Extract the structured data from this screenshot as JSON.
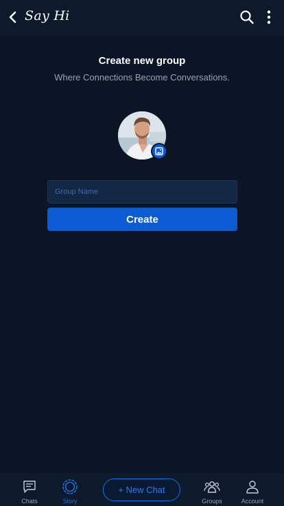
{
  "header": {
    "app_title": "Say Hi",
    "back_icon": "chevron-left-icon",
    "search_icon": "search-icon",
    "more_icon": "more-vertical-icon"
  },
  "main": {
    "title": "Create new group",
    "subtitle": "Where Connections Become Conversations.",
    "group_name_placeholder": "Group Name",
    "group_name_value": "",
    "create_label": "Create",
    "avatar_badge_icon": "image-icon"
  },
  "bottom_nav": {
    "items": [
      {
        "label": "Chats",
        "icon": "chat-icon",
        "active": false
      },
      {
        "label": "Story",
        "icon": "story-icon",
        "active": true
      },
      {
        "label": "Groups",
        "icon": "groups-icon",
        "active": false
      },
      {
        "label": "Account",
        "icon": "account-icon",
        "active": false
      }
    ],
    "new_chat_label": "+ New Chat"
  },
  "colors": {
    "background": "#0b1525",
    "bar": "#0d1a2c",
    "accent": "#0b5bd3",
    "active": "#1f6fe0",
    "muted_text": "#9aa3b0"
  }
}
